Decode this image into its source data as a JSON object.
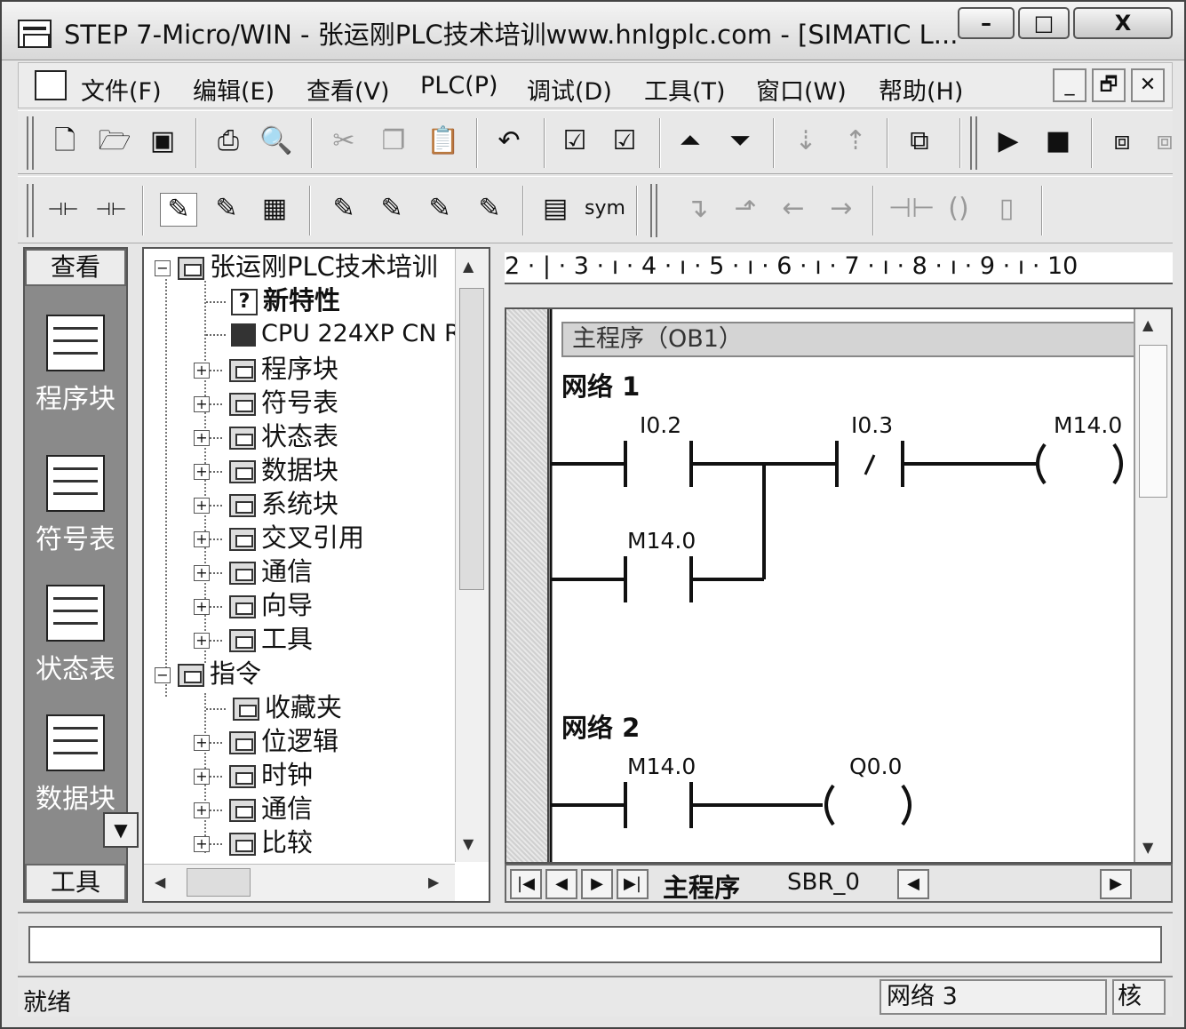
{
  "window": {
    "title": "STEP 7-Micro/WIN - 张运刚PLC技术培训www.hnlgplc.com - [SIMATIC L...",
    "buttons": {
      "minimize": "–",
      "maximize": "□",
      "close": "X"
    }
  },
  "menubar": {
    "items": [
      "文件(F)",
      "编辑(E)",
      "查看(V)",
      "PLC(P)",
      "调试(D)",
      "工具(T)",
      "窗口(W)",
      "帮助(H)"
    ],
    "mdi_buttons": [
      "_",
      "🗗",
      "✕"
    ]
  },
  "toolbar2": {
    "sym_label": "sym"
  },
  "nav": {
    "header": "查看",
    "items": [
      "程序块",
      "符号表",
      "状态表",
      "数据块"
    ],
    "footer": "工具"
  },
  "tree": {
    "root": "张运刚PLC技术培训",
    "new_features": "新特性",
    "cpu": "CPU 224XP CN R",
    "project_items": [
      "程序块",
      "符号表",
      "状态表",
      "数据块",
      "系统块",
      "交叉引用",
      "通信",
      "向导",
      "工具"
    ],
    "instructions": "指令",
    "instruction_items": [
      "收藏夹",
      "位逻辑",
      "时钟",
      "通信",
      "比较"
    ]
  },
  "ruler": {
    "text": "2 · | · 3 · ı · 4 · ı · 5 · ı · 6 · ı · 7 · ı · 8 · ı · 9 · ı · 10"
  },
  "editor": {
    "pou_header": "主程序（OB1）",
    "networks": [
      {
        "title": "网络 1",
        "operands": {
          "contact1": "I0.2",
          "contact2": "I0.3",
          "coil": "M14.0",
          "parallel": "M14.0"
        }
      },
      {
        "title": "网络 2",
        "operands": {
          "contact": "M14.0",
          "coil": "Q0.0"
        }
      }
    ]
  },
  "tabs": {
    "main": "主程序",
    "sbr": "SBR_0"
  },
  "status": {
    "text": "就绪",
    "network": "网络 3",
    "mode": "核"
  }
}
